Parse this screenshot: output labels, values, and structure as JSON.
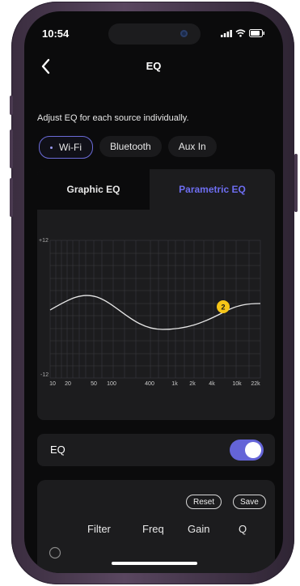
{
  "status_bar": {
    "time": "10:54"
  },
  "header": {
    "title": "EQ"
  },
  "subtitle": "Adjust EQ for each source individually.",
  "sources": [
    {
      "label": "Wi-Fi",
      "active": true
    },
    {
      "label": "Bluetooth",
      "active": false
    },
    {
      "label": "Aux In",
      "active": false
    }
  ],
  "tabs": {
    "graphic": "Graphic EQ",
    "parametric": "Parametric EQ"
  },
  "chart": {
    "y_top": "+12",
    "y_bottom": "-12",
    "x_ticks": [
      "10",
      "20",
      "50",
      "100",
      "400",
      "1k",
      "2k",
      "4k",
      "10k",
      "22k"
    ],
    "marker_label": "2"
  },
  "eq_toggle": {
    "label": "EQ",
    "enabled": true
  },
  "filters": {
    "reset_label": "Reset",
    "save_label": "Save",
    "columns": [
      "Filter",
      "Freq",
      "Gain",
      "Q"
    ]
  },
  "colors": {
    "accent": "#6464d8",
    "marker": "#f5c518"
  }
}
